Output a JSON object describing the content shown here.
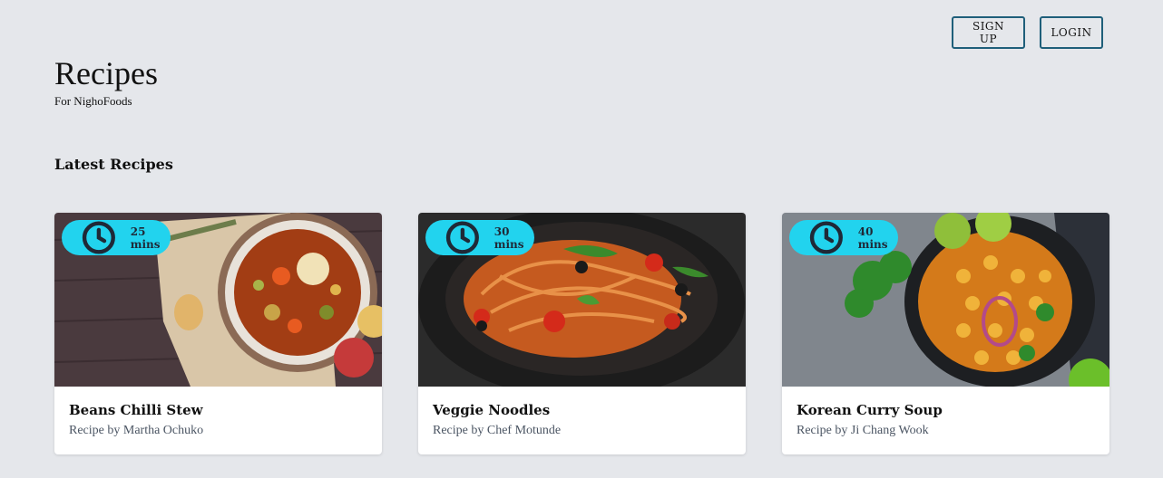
{
  "header": {
    "title": "Recipes",
    "subtitle": "For NighoFoods",
    "signup_label": "SIGN UP",
    "login_label": "LOGIN"
  },
  "section": {
    "heading": "Latest Recipes"
  },
  "recipes": [
    {
      "time": "25 mins",
      "title": "Beans Chilli Stew",
      "author": "Recipe by Martha Ochuko"
    },
    {
      "time": "30 mins",
      "title": "Veggie Noodles",
      "author": "Recipe by Chef Motunde"
    },
    {
      "time": "40 mins",
      "title": "Korean Curry Soup",
      "author": "Recipe by Ji Chang Wook"
    }
  ],
  "colors": {
    "background": "#e5e7eb",
    "badge": "#22d3ee",
    "button_border": "#1f5f7a"
  },
  "icons": {
    "time": "clock-icon"
  }
}
